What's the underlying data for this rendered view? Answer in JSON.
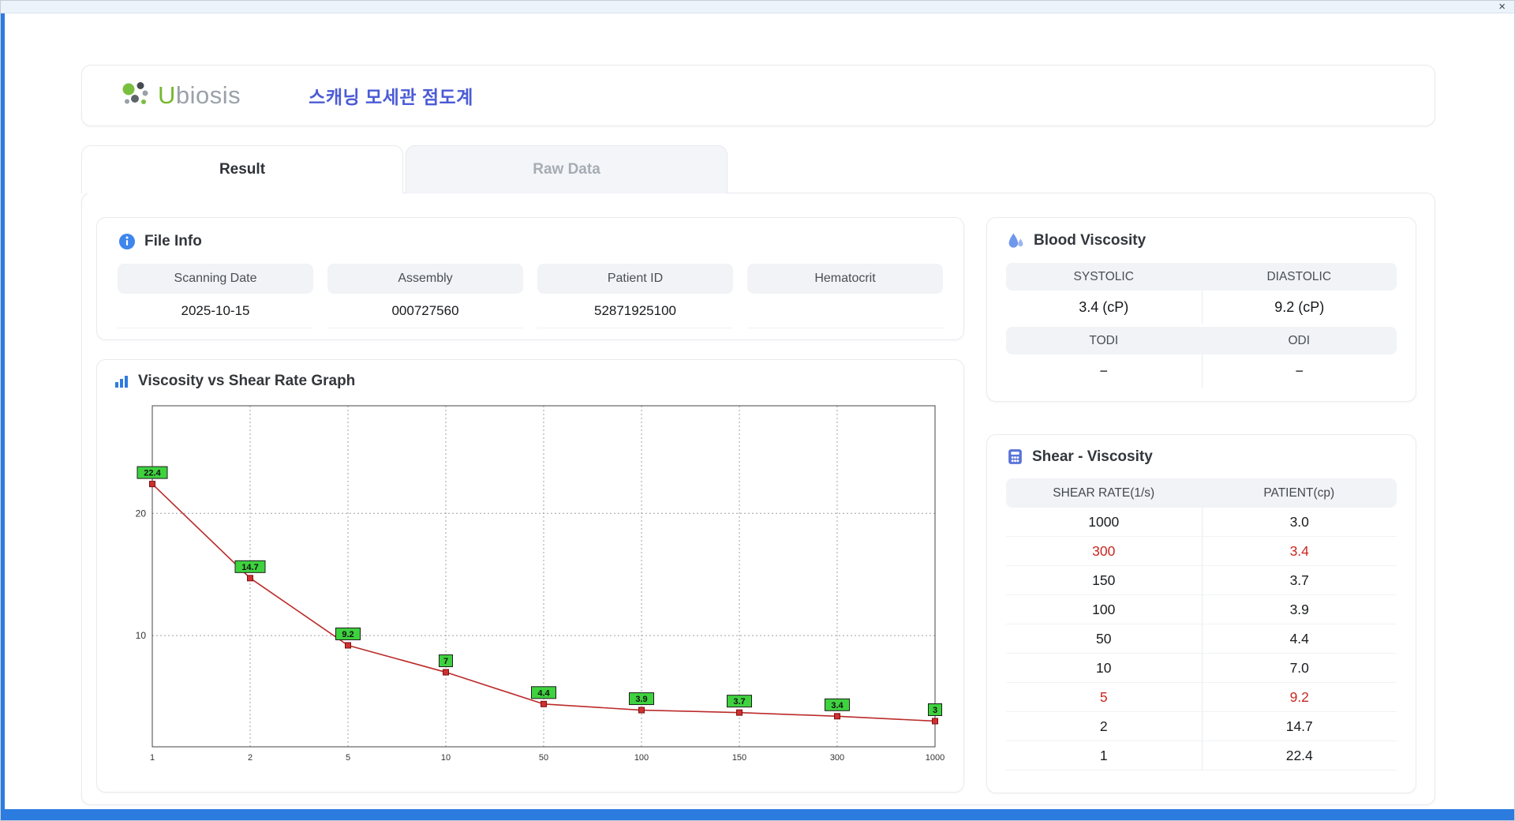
{
  "window": {
    "close_icon": "×"
  },
  "header": {
    "logo_u": "U",
    "logo_rest": "biosis",
    "title": "스캐닝 모세관 점도계"
  },
  "tabs": [
    {
      "label": "Result"
    },
    {
      "label": "Raw Data"
    }
  ],
  "file_info": {
    "title": "File Info",
    "fields": [
      {
        "label": "Scanning Date",
        "value": "2025-10-15"
      },
      {
        "label": "Assembly",
        "value": "000727560"
      },
      {
        "label": "Patient ID",
        "value": "52871925100"
      },
      {
        "label": "Hematocrit",
        "value": ""
      }
    ]
  },
  "chart_data": {
    "type": "line",
    "title": "Viscosity vs Shear Rate Graph",
    "x": [
      1,
      2,
      5,
      10,
      50,
      100,
      150,
      300,
      1000
    ],
    "values": [
      22.4,
      14.7,
      9.2,
      7.0,
      4.4,
      3.9,
      3.7,
      3.4,
      3.0
    ],
    "point_labels": [
      "22.4",
      "14.7",
      "9.2",
      "7",
      "4.4",
      "3.9",
      "3.7",
      "3.4",
      "3"
    ],
    "x_scale": "category",
    "y_ticks": [
      10,
      20
    ],
    "ylim": [
      0.9,
      28.8
    ],
    "grid": true,
    "line_color": "#bb2b2b",
    "marker_color": "#d03030",
    "marker_edge": "#7a1010",
    "label_bg": "#3ed23e",
    "label_border": "#1c1c1c"
  },
  "blood_viscosity": {
    "title": "Blood Viscosity",
    "sections": [
      {
        "labels": [
          "SYSTOLIC",
          "DIASTOLIC"
        ],
        "values": [
          "3.4 (cP)",
          "9.2 (cP)"
        ]
      },
      {
        "labels": [
          "TODI",
          "ODI"
        ],
        "values": [
          "−",
          "−"
        ]
      }
    ]
  },
  "shear_viscosity": {
    "title": "Shear - Viscosity",
    "columns": [
      "SHEAR RATE(1/s)",
      "PATIENT(cp)"
    ],
    "highlight_color": "#c8271f",
    "rows": [
      {
        "rate": "1000",
        "patient": "3.0"
      },
      {
        "rate": "300",
        "patient": "3.4",
        "color": "#c8271f"
      },
      {
        "rate": "150",
        "patient": "3.7"
      },
      {
        "rate": "100",
        "patient": "3.9"
      },
      {
        "rate": "50",
        "patient": "4.4"
      },
      {
        "rate": "10",
        "patient": "7.0"
      },
      {
        "rate": "5",
        "patient": "9.2",
        "color": "#c8271f"
      },
      {
        "rate": "2",
        "patient": "14.7"
      },
      {
        "rate": "1",
        "patient": "22.4"
      }
    ]
  }
}
